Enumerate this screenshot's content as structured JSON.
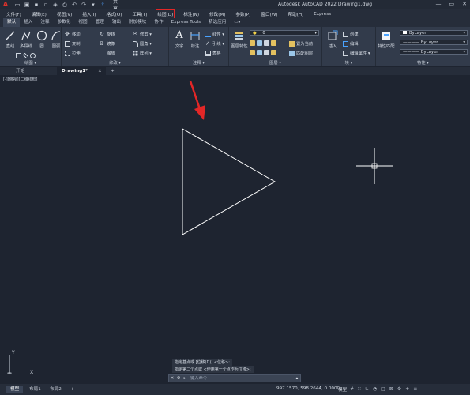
{
  "app": {
    "logo": "A",
    "title": "Autodesk AutoCAD 2022   Drawing1.dwg",
    "share_label": "共享"
  },
  "menubar": [
    "文件(F)",
    "编辑(E)",
    "视图(V)",
    "插入(I)",
    "格式(O)",
    "工具(T)",
    "绘图(D)",
    "标注(N)",
    "修改(M)",
    "参数(P)",
    "窗口(W)",
    "帮助(H)",
    "Express"
  ],
  "menubar_highlight": "绘图(D)",
  "ribbon_tabs": [
    "默认",
    "插入",
    "注释",
    "参数化",
    "视图",
    "管理",
    "输出",
    "附加模块",
    "协作",
    "Express Tools",
    "精选应用",
    "▭▾"
  ],
  "ribbon": {
    "draw": {
      "label": "绘图 ▾",
      "buttons": [
        "直线",
        "多段线",
        "圆",
        "圆弧"
      ]
    },
    "modify": {
      "label": "修改 ▾",
      "items": [
        "移动",
        "旋转",
        "修剪 ▾",
        "复制",
        "镜像",
        "圆角 ▾",
        "拉伸",
        "缩放",
        "阵列 ▾"
      ]
    },
    "annotation": {
      "label": "注释 ▾",
      "buttons": [
        "文字",
        "标注"
      ],
      "items": [
        "线性 ▾",
        "引线 ▾",
        "表格"
      ]
    },
    "layers": {
      "label": "图层 ▾",
      "layer_value": "0",
      "buttons": [
        "图层特性"
      ],
      "items": [
        "置为当前",
        "匹配图层"
      ]
    },
    "block": {
      "label": "块 ▾",
      "buttons": [
        "插入"
      ],
      "items": [
        "创建",
        "编辑",
        "编辑属性 ▾"
      ]
    },
    "properties": {
      "label": "特性 ▾",
      "buttons": [
        "特性匹配"
      ],
      "dropdowns": [
        "ByLayer",
        "———— ByLayer",
        "———— ByLayer"
      ]
    }
  },
  "file_tabs": [
    "开始",
    "Drawing1*"
  ],
  "new_tab_icon": "+",
  "viewport_controls": "[-][俯视][二维线框]",
  "command_history": [
    "指定基点或 [位移(D)] <位移>:",
    "指定第二个点或 <使用第一个点作为位移>:"
  ],
  "command_input_placeholder": "键入命令",
  "ucs": {
    "y": "Y",
    "x": "X"
  },
  "layout_tabs": [
    "模型",
    "布局1",
    "布局2"
  ],
  "status": {
    "coordinates": "997.1570, 598.2644, 0.0000",
    "mode": "模型",
    "icons": [
      "grid-icon",
      "snap-icon",
      "ortho-icon",
      "polar-icon",
      "osnap-icon",
      "scale-icon",
      "gear-icon",
      "plus-icon",
      "menu-icon"
    ]
  },
  "colors": {
    "background": "#1e2430",
    "ribbon": "#323b4b",
    "highlight": "#e32727",
    "drawing_line": "#ffffff"
  }
}
